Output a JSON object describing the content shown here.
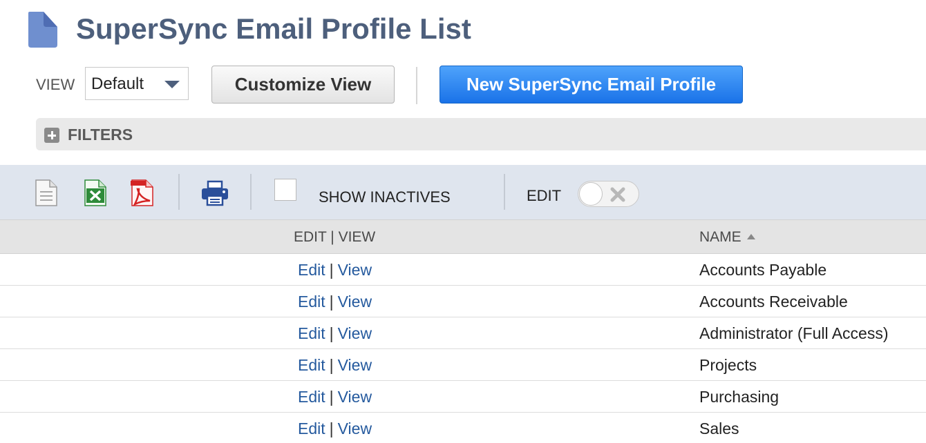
{
  "page": {
    "title": "SuperSync Email Profile List",
    "icon": "document-icon"
  },
  "toolbar": {
    "view_label": "VIEW",
    "view_selected": "Default",
    "customize_label": "Customize View",
    "new_label": "New SuperSync Email Profile"
  },
  "filters": {
    "label": "FILTERS",
    "icon": "plus-icon"
  },
  "iconbar": {
    "icons": [
      "export-csv-icon",
      "export-excel-icon",
      "export-pdf-icon",
      "print-icon"
    ],
    "show_inactives_label": "SHOW INACTIVES",
    "show_inactives_checked": false,
    "edit_label": "EDIT",
    "edit_toggle_on": false
  },
  "table": {
    "headers": {
      "edit_view": "EDIT | VIEW",
      "name": "NAME"
    },
    "sort": "name-ascending",
    "rows": [
      {
        "edit": "Edit",
        "sep": "|",
        "view": "View",
        "name": "Accounts Payable"
      },
      {
        "edit": "Edit",
        "sep": "|",
        "view": "View",
        "name": "Accounts Receivable"
      },
      {
        "edit": "Edit",
        "sep": "|",
        "view": "View",
        "name": "Administrator (Full Access)"
      },
      {
        "edit": "Edit",
        "sep": "|",
        "view": "View",
        "name": "Projects"
      },
      {
        "edit": "Edit",
        "sep": "|",
        "view": "View",
        "name": "Purchasing"
      },
      {
        "edit": "Edit",
        "sep": "|",
        "view": "View",
        "name": "Sales"
      }
    ]
  },
  "colors": {
    "title": "#4d5f7c",
    "link": "#255a9e",
    "primary_button": "#1a72e8",
    "iconbar_bg": "#dfe5ee",
    "header_bg": "#e4e4e4"
  }
}
